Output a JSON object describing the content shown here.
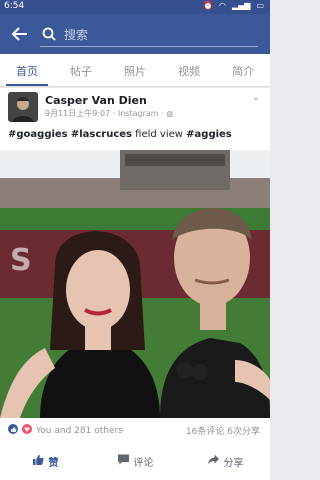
{
  "status": {
    "time": "6:54"
  },
  "search": {
    "placeholder": "搜索"
  },
  "tabs": [
    {
      "label": "首页"
    },
    {
      "label": "帖子"
    },
    {
      "label": "照片"
    },
    {
      "label": "视频"
    },
    {
      "label": "简介"
    }
  ],
  "post": {
    "author": "Casper Van Dien",
    "meta": "9月11日上午9:07 · Instagram · ",
    "caption_tags": [
      "#goaggies",
      "#lascruces",
      "#aggies"
    ],
    "caption_text": "field view"
  },
  "reactions": {
    "summary": "You and 281 others",
    "stats": "16条评论 6次分享"
  },
  "actions": [
    {
      "label": "赞"
    },
    {
      "label": "评论"
    },
    {
      "label": "分享"
    }
  ],
  "colors": {
    "brand": "#3b5998",
    "statusbar": "#36508f"
  }
}
